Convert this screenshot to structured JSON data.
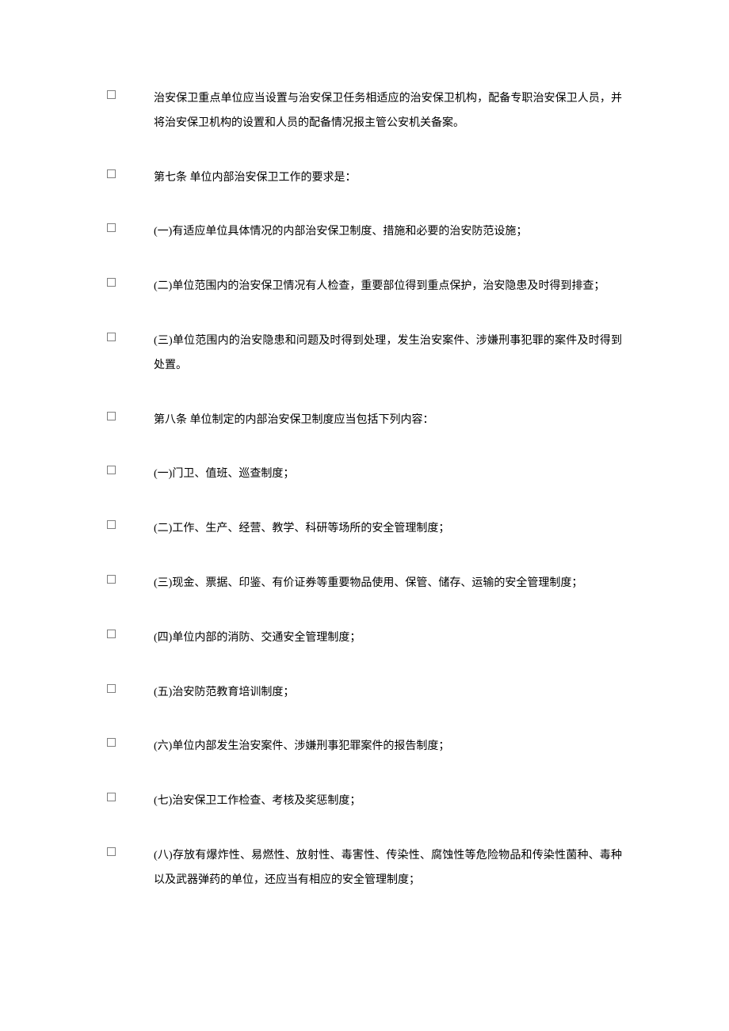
{
  "items": [
    {
      "text": "治安保卫重点单位应当设置与治安保卫任务相适应的治安保卫机构，配备专职治安保卫人员，并将治安保卫机构的设置和人员的配备情况报主管公安机关备案。"
    },
    {
      "text": "第七条 单位内部治安保卫工作的要求是："
    },
    {
      "text": "(一)有适应单位具体情况的内部治安保卫制度、措施和必要的治安防范设施；"
    },
    {
      "text": "(二)单位范围内的治安保卫情况有人检查，重要部位得到重点保护，治安隐患及时得到排查；"
    },
    {
      "text": "(三)单位范围内的治安隐患和问题及时得到处理，发生治安案件、涉嫌刑事犯罪的案件及时得到处置。"
    },
    {
      "text": "第八条 单位制定的内部治安保卫制度应当包括下列内容："
    },
    {
      "text": "(一)门卫、值班、巡查制度；"
    },
    {
      "text": "(二)工作、生产、经营、教学、科研等场所的安全管理制度；"
    },
    {
      "text": "(三)现金、票据、印鉴、有价证券等重要物品使用、保管、储存、运输的安全管理制度；"
    },
    {
      "text": "(四)单位内部的消防、交通安全管理制度；"
    },
    {
      "text": "(五)治安防范教育培训制度；"
    },
    {
      "text": "(六)单位内部发生治安案件、涉嫌刑事犯罪案件的报告制度；"
    },
    {
      "text": "(七)治安保卫工作检查、考核及奖惩制度；"
    },
    {
      "text": "(八)存放有爆炸性、易燃性、放射性、毒害性、传染性、腐蚀性等危险物品和传染性菌种、毒种以及武器弹药的单位，还应当有相应的安全管理制度；"
    }
  ]
}
